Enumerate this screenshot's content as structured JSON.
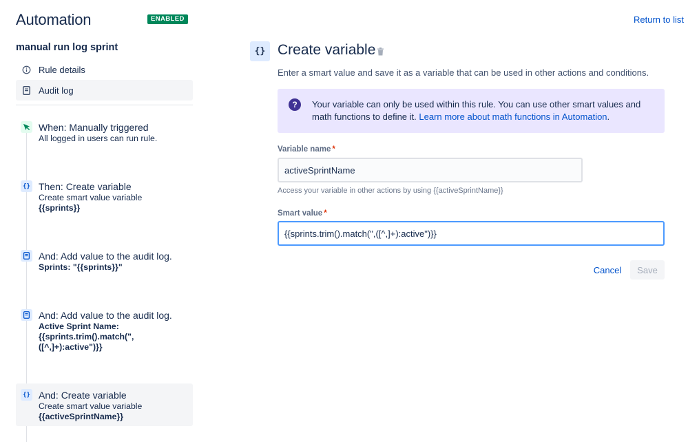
{
  "header": {
    "app_title": "Automation",
    "status_badge": "ENABLED",
    "return_link": "Return to list"
  },
  "sidebar": {
    "rule_name": "manual run log sprint",
    "nav": [
      {
        "label": "Rule details",
        "icon": "info-icon"
      },
      {
        "label": "Audit log",
        "icon": "audit-log-icon"
      }
    ],
    "steps": [
      {
        "title": "When: Manually triggered",
        "desc": "All logged in users can run rule.",
        "strong": "",
        "icon": "cursor-click-icon"
      },
      {
        "title": "Then: Create variable",
        "desc": "Create smart value variable",
        "strong": "{{sprints}}",
        "icon": "curly-braces-icon"
      },
      {
        "title": "And: Add value to the audit log.",
        "desc": "",
        "strong": "Sprints: \"{{sprints}}\"",
        "icon": "audit-log-icon"
      },
      {
        "title": "And: Add value to the audit log.",
        "desc": "",
        "strong": "Active Sprint Name:",
        "strong2": "{{sprints.trim().match(\",",
        "strong3": "([^,]+):active\")}}",
        "icon": "audit-log-icon"
      },
      {
        "title": "And: Create variable",
        "desc": "Create smart value variable",
        "strong": "{{activeSprintName}}",
        "icon": "curly-braces-icon"
      }
    ]
  },
  "panel": {
    "icon_glyph": "{}",
    "title": "Create variable",
    "subtitle": "Enter a smart value and save it as a variable that can be used in other actions and conditions.",
    "info": {
      "text": "Your variable can only be used within this rule. You can use other smart values and math functions to define it. ",
      "link": "Learn more about math functions in Automation",
      "after_link": "."
    },
    "variable_name": {
      "label": "Variable name",
      "required_mark": "*",
      "value": "activeSprintName",
      "helper": "Access your variable in other actions by using {{activeSprintName}}"
    },
    "smart_value": {
      "label": "Smart value",
      "required_mark": "*",
      "value": "{{sprints.trim().match(\",([^,]+):active\")}}"
    },
    "cancel_label": "Cancel",
    "save_label": "Save"
  },
  "colors": {
    "enabled_badge": "#00875a",
    "link": "#0052cc",
    "info_bg": "#eae6ff",
    "focus_border": "#4c9aff"
  }
}
